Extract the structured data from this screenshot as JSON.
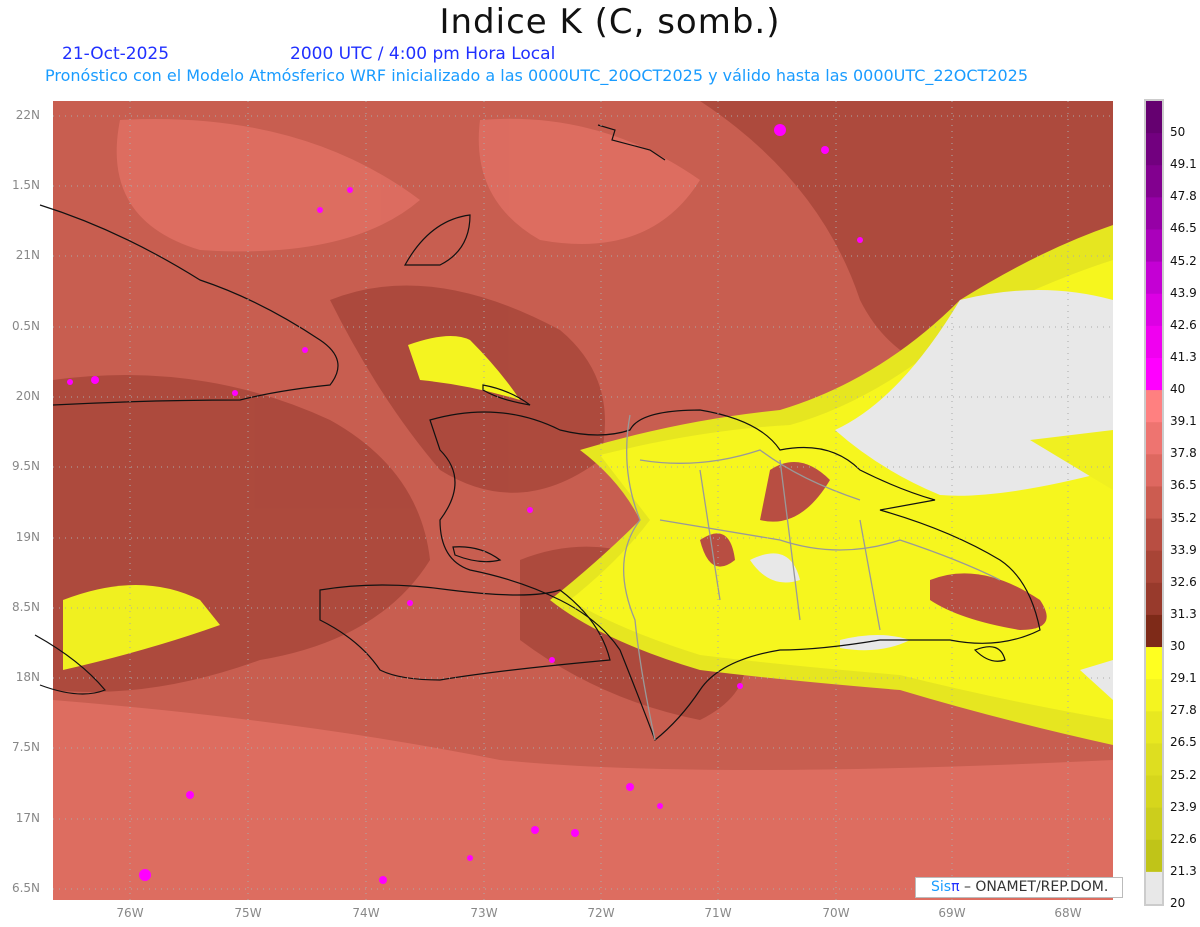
{
  "header": {
    "title": "Indice K (C, somb.)",
    "date": "21-Oct-2025",
    "time": "2000 UTC / 4:00 pm Hora Local",
    "subtitle": "Pronóstico con el Modelo Atmósferico WRF inicializado a las 0000UTC_20OCT2025 y válido hasta las  0000UTC_22OCT2025"
  },
  "axes": {
    "y_ticks": [
      "22N",
      "1.5N",
      "21N",
      "0.5N",
      "20N",
      "9.5N",
      "19N",
      "8.5N",
      "18N",
      "7.5N",
      "17N",
      "6.5N"
    ],
    "x_ticks": [
      "76W",
      "75W",
      "74W",
      "73W",
      "72W",
      "71W",
      "70W",
      "69W",
      "68W"
    ]
  },
  "colorbar": {
    "labels": [
      "50",
      "49.1",
      "47.8",
      "46.5",
      "45.2",
      "43.9",
      "42.6",
      "41.3",
      "40",
      "39.1",
      "37.8",
      "36.5",
      "35.2",
      "33.9",
      "32.6",
      "31.3",
      "30",
      "29.1",
      "27.8",
      "26.5",
      "25.2",
      "23.9",
      "22.6",
      "21.3",
      "20"
    ],
    "colors": [
      "#650070",
      "#72007f",
      "#82008f",
      "#9600a6",
      "#aa00bb",
      "#c400d4",
      "#dc00e4",
      "#f000f0",
      "#ff00ff",
      "#ff8080",
      "#ee7470",
      "#de6860",
      "#cc5c50",
      "#b84e42",
      "#a84436",
      "#983a2c",
      "#7e2a18",
      "#ffff20",
      "#f4f420",
      "#e8e820",
      "#dede20",
      "#d6d61c",
      "#ccce1c",
      "#c0c418",
      "#e8e8e8"
    ]
  },
  "credit": {
    "brand": "Sis",
    "brand_symbol": "π",
    "text": " –  ONAMET/REP.DOM."
  }
}
